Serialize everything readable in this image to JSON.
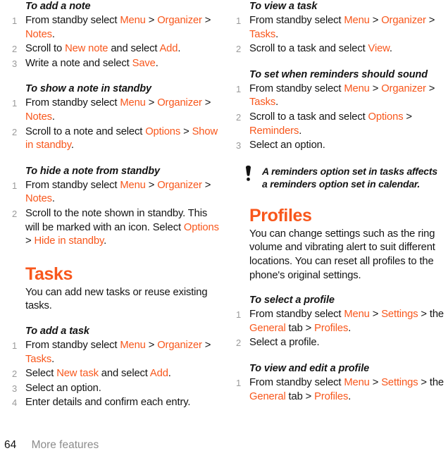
{
  "accent_color": "#f8571c",
  "text_color": "#141414",
  "muted_color": "#9a9a9a",
  "footer": {
    "page_number": "64",
    "section_label": "More features"
  },
  "left_column": {
    "proc_add_note": {
      "title": "To add a note",
      "steps": [
        {
          "num": "1",
          "parts": [
            {
              "t": "From standby select ",
              "hl": false
            },
            {
              "t": "Menu",
              "hl": true
            },
            {
              "t": " > ",
              "hl": false
            },
            {
              "t": "Organizer",
              "hl": true
            },
            {
              "t": " > ",
              "hl": false
            },
            {
              "t": "Notes",
              "hl": true
            },
            {
              "t": ".",
              "hl": false
            }
          ]
        },
        {
          "num": "2",
          "parts": [
            {
              "t": "Scroll to ",
              "hl": false
            },
            {
              "t": "New note",
              "hl": true
            },
            {
              "t": " and select ",
              "hl": false
            },
            {
              "t": "Add",
              "hl": true
            },
            {
              "t": ".",
              "hl": false
            }
          ]
        },
        {
          "num": "3",
          "parts": [
            {
              "t": "Write a note and select ",
              "hl": false
            },
            {
              "t": "Save",
              "hl": true
            },
            {
              "t": ".",
              "hl": false
            }
          ]
        }
      ]
    },
    "proc_show_note": {
      "title": "To show a note in standby",
      "steps": [
        {
          "num": "1",
          "parts": [
            {
              "t": "From standby select ",
              "hl": false
            },
            {
              "t": "Menu",
              "hl": true
            },
            {
              "t": " > ",
              "hl": false
            },
            {
              "t": "Organizer",
              "hl": true
            },
            {
              "t": " > ",
              "hl": false
            },
            {
              "t": "Notes",
              "hl": true
            },
            {
              "t": ".",
              "hl": false
            }
          ]
        },
        {
          "num": "2",
          "parts": [
            {
              "t": "Scroll to a note and select ",
              "hl": false
            },
            {
              "t": "Options",
              "hl": true
            },
            {
              "t": " > ",
              "hl": false
            },
            {
              "t": "Show in standby",
              "hl": true
            },
            {
              "t": ".",
              "hl": false
            }
          ]
        }
      ]
    },
    "proc_hide_note": {
      "title": "To hide a note from standby",
      "steps": [
        {
          "num": "1",
          "parts": [
            {
              "t": "From standby select ",
              "hl": false
            },
            {
              "t": "Menu",
              "hl": true
            },
            {
              "t": " > ",
              "hl": false
            },
            {
              "t": "Organizer",
              "hl": true
            },
            {
              "t": " > ",
              "hl": false
            },
            {
              "t": "Notes",
              "hl": true
            },
            {
              "t": ".",
              "hl": false
            }
          ]
        },
        {
          "num": "2",
          "parts": [
            {
              "t": "Scroll to the note shown in standby. This will be marked with an icon. Select ",
              "hl": false
            },
            {
              "t": "Options",
              "hl": true
            },
            {
              "t": " > ",
              "hl": false
            },
            {
              "t": "Hide in standby",
              "hl": true
            },
            {
              "t": ".",
              "hl": false
            }
          ]
        }
      ]
    },
    "section_tasks": {
      "heading": "Tasks",
      "body": "You can add new tasks or reuse existing tasks."
    },
    "proc_add_task": {
      "title": "To add a task",
      "steps": [
        {
          "num": "1",
          "parts": [
            {
              "t": "From standby select ",
              "hl": false
            },
            {
              "t": "Menu",
              "hl": true
            },
            {
              "t": " > ",
              "hl": false
            },
            {
              "t": "Organizer",
              "hl": true
            },
            {
              "t": " > ",
              "hl": false
            },
            {
              "t": "Tasks",
              "hl": true
            },
            {
              "t": ".",
              "hl": false
            }
          ]
        },
        {
          "num": "2",
          "parts": [
            {
              "t": "Select ",
              "hl": false
            },
            {
              "t": "New task",
              "hl": true
            },
            {
              "t": " and select ",
              "hl": false
            },
            {
              "t": "Add",
              "hl": true
            },
            {
              "t": ".",
              "hl": false
            }
          ]
        },
        {
          "num": "3",
          "parts": [
            {
              "t": "Select an option.",
              "hl": false
            }
          ]
        },
        {
          "num": "4",
          "parts": [
            {
              "t": "Enter details and confirm each entry.",
              "hl": false
            }
          ]
        }
      ]
    }
  },
  "right_column": {
    "proc_view_task": {
      "title": "To view a task",
      "steps": [
        {
          "num": "1",
          "parts": [
            {
              "t": "From standby select ",
              "hl": false
            },
            {
              "t": "Menu",
              "hl": true
            },
            {
              "t": " > ",
              "hl": false
            },
            {
              "t": "Organizer",
              "hl": true
            },
            {
              "t": " > ",
              "hl": false
            },
            {
              "t": "Tasks",
              "hl": true
            },
            {
              "t": ".",
              "hl": false
            }
          ]
        },
        {
          "num": "2",
          "parts": [
            {
              "t": "Scroll to a task and select ",
              "hl": false
            },
            {
              "t": "View",
              "hl": true
            },
            {
              "t": ".",
              "hl": false
            }
          ]
        }
      ]
    },
    "proc_reminders": {
      "title": "To set when reminders should sound",
      "steps": [
        {
          "num": "1",
          "parts": [
            {
              "t": "From standby select ",
              "hl": false
            },
            {
              "t": "Menu",
              "hl": true
            },
            {
              "t": " > ",
              "hl": false
            },
            {
              "t": "Organizer",
              "hl": true
            },
            {
              "t": " > ",
              "hl": false
            },
            {
              "t": "Tasks",
              "hl": true
            },
            {
              "t": ".",
              "hl": false
            }
          ]
        },
        {
          "num": "2",
          "parts": [
            {
              "t": "Scroll to a task and select ",
              "hl": false
            },
            {
              "t": "Options",
              "hl": true
            },
            {
              "t": " > ",
              "hl": false
            },
            {
              "t": "Reminders",
              "hl": true
            },
            {
              "t": ".",
              "hl": false
            }
          ]
        },
        {
          "num": "3",
          "parts": [
            {
              "t": "Select an option.",
              "hl": false
            }
          ]
        }
      ]
    },
    "callout": {
      "icon": "exclamation-note-icon",
      "text": "A reminders option set in tasks affects a reminders option set in calendar."
    },
    "section_profiles": {
      "heading": "Profiles",
      "body": "You can change settings such as the ring volume and vibrating alert to suit different locations. You can reset all profiles to the phone's original settings."
    },
    "proc_select_profile": {
      "title": "To select a profile",
      "steps": [
        {
          "num": "1",
          "parts": [
            {
              "t": "From standby select ",
              "hl": false
            },
            {
              "t": "Menu",
              "hl": true
            },
            {
              "t": " > ",
              "hl": false
            },
            {
              "t": "Settings",
              "hl": true
            },
            {
              "t": " > the ",
              "hl": false
            },
            {
              "t": "General",
              "hl": true
            },
            {
              "t": " tab > ",
              "hl": false
            },
            {
              "t": "Profiles",
              "hl": true
            },
            {
              "t": ".",
              "hl": false
            }
          ]
        },
        {
          "num": "2",
          "parts": [
            {
              "t": "Select a profile.",
              "hl": false
            }
          ]
        }
      ]
    },
    "proc_view_edit_profile": {
      "title": "To view and edit a profile",
      "steps": [
        {
          "num": "1",
          "parts": [
            {
              "t": "From standby select ",
              "hl": false
            },
            {
              "t": "Menu",
              "hl": true
            },
            {
              "t": " > ",
              "hl": false
            },
            {
              "t": "Settings",
              "hl": true
            },
            {
              "t": " > the ",
              "hl": false
            },
            {
              "t": "General",
              "hl": true
            },
            {
              "t": " tab > ",
              "hl": false
            },
            {
              "t": "Profiles",
              "hl": true
            },
            {
              "t": ".",
              "hl": false
            }
          ]
        }
      ]
    }
  }
}
